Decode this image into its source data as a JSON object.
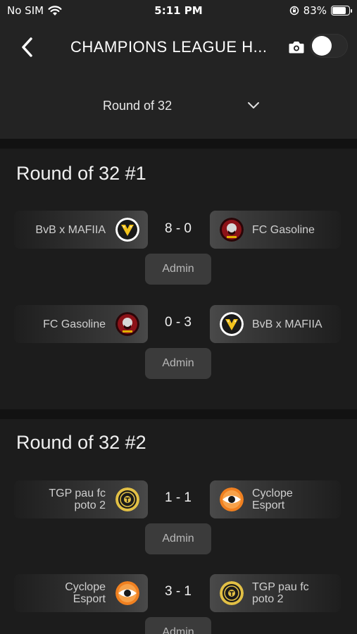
{
  "status_bar": {
    "carrier": "No SIM",
    "time": "5:11 PM",
    "battery_pct_label": "83%",
    "battery_level": 0.83
  },
  "header": {
    "title": "CHAMPIONS LEAGUE H...",
    "toggle_on": false,
    "round_selected": "Round of 32"
  },
  "sections": [
    {
      "title": "Round of 32 #1",
      "matches": [
        {
          "home": "BvB x MAFIIA",
          "home_logo": "bvb-logo",
          "score": "8 - 0",
          "away": "FC Gasoline",
          "away_logo": "gasoline-logo",
          "admin_label": "Admin"
        },
        {
          "home": "FC Gasoline",
          "home_logo": "gasoline-logo",
          "score": "0 - 3",
          "away": "BvB x MAFIIA",
          "away_logo": "bvb-logo",
          "admin_label": "Admin"
        }
      ]
    },
    {
      "title": "Round of 32 #2",
      "matches": [
        {
          "home": "TGP pau fc poto 2",
          "home_logo": "tgp-logo",
          "score": "1 - 1",
          "away": "Cyclope Esport",
          "away_logo": "cyclope-logo",
          "admin_label": "Admin"
        },
        {
          "home": "Cyclope Esport",
          "home_logo": "cyclope-logo",
          "score": "3 - 1",
          "away": "TGP pau fc poto 2",
          "away_logo": "tgp-logo",
          "admin_label": "Admin"
        }
      ]
    }
  ]
}
